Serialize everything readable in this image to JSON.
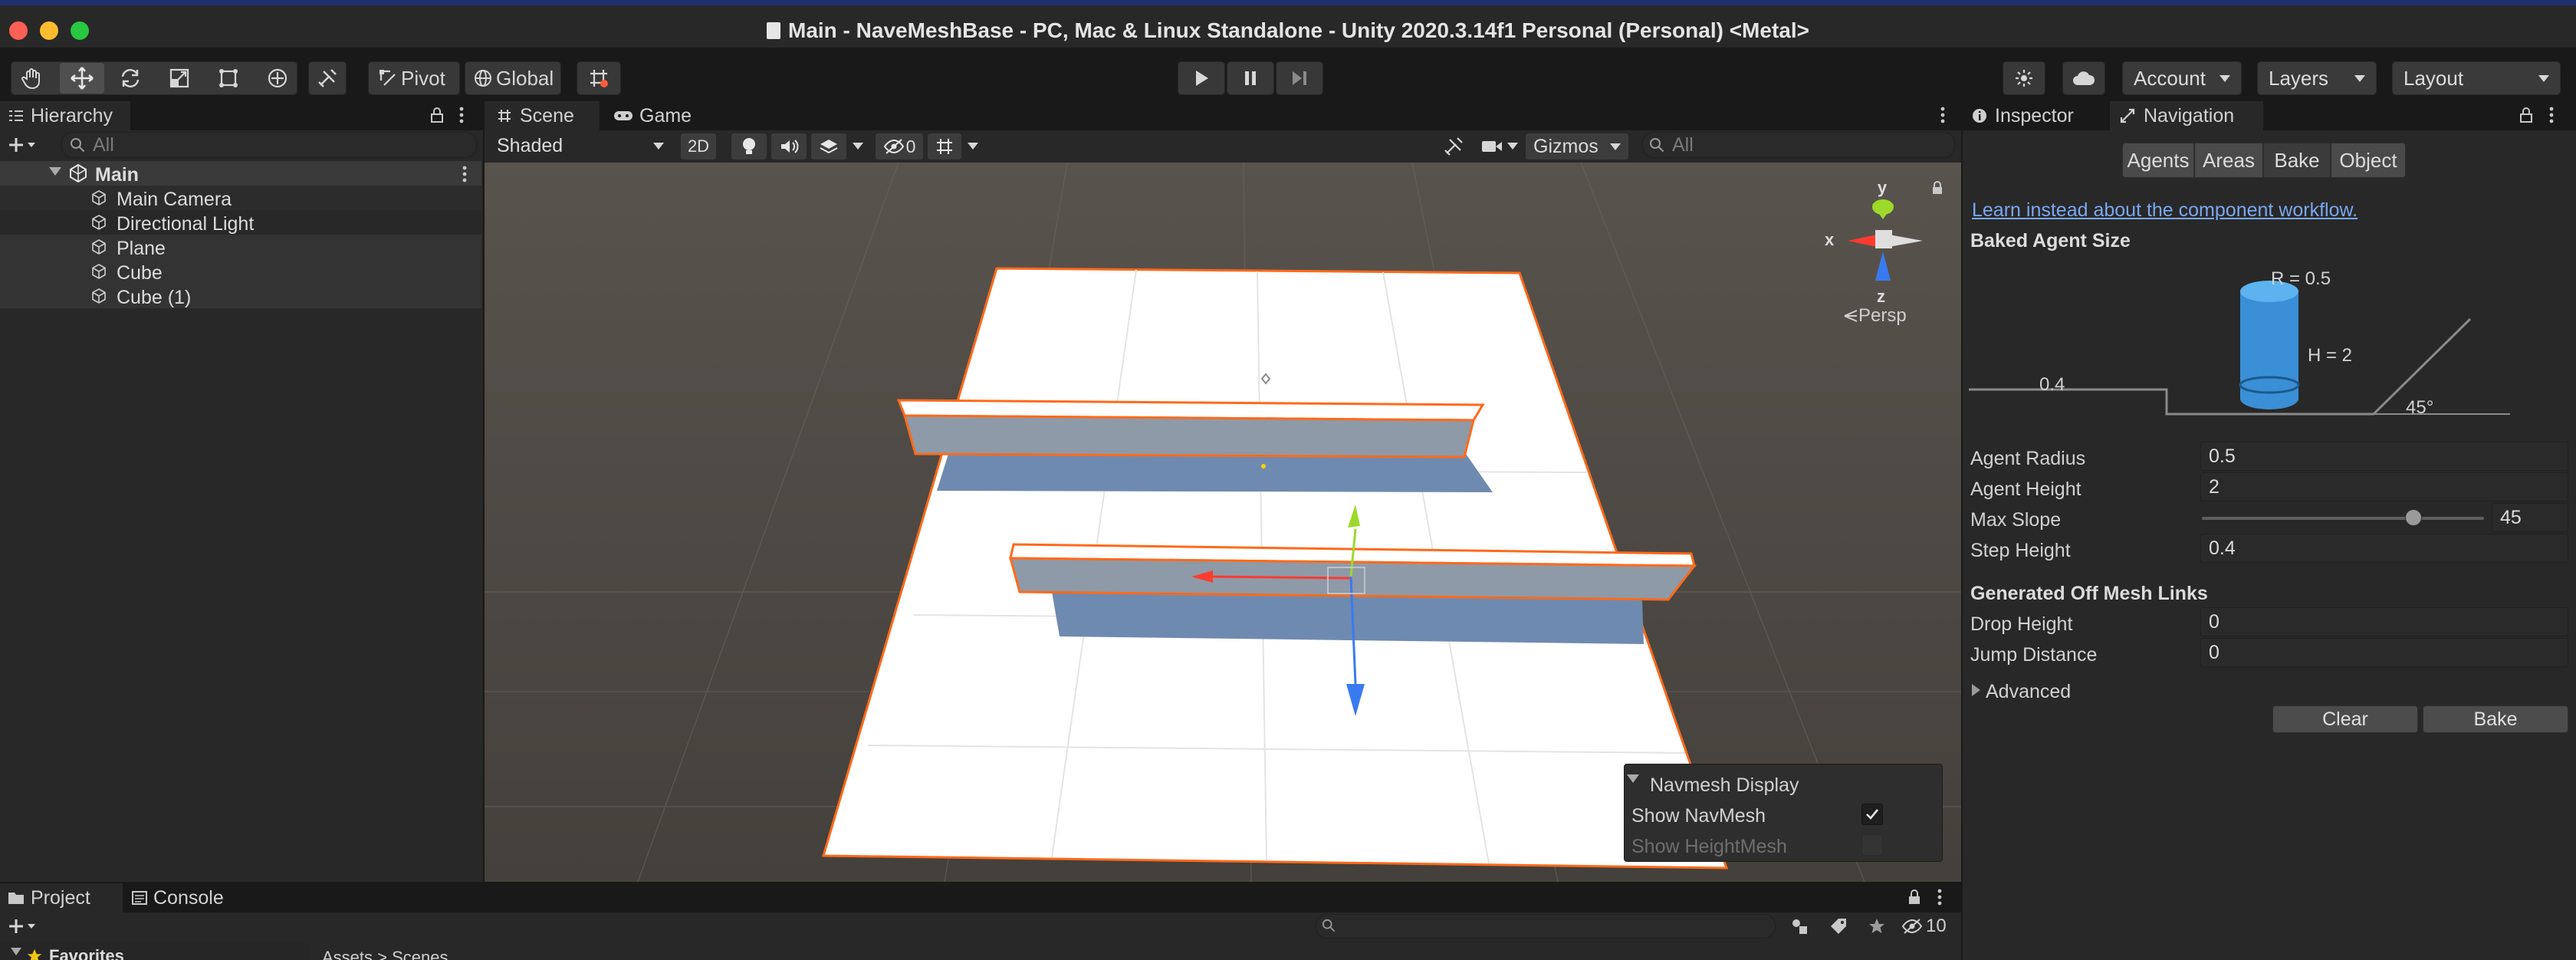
{
  "window": {
    "title": "Main - NaveMeshBase - PC, Mac & Linux Standalone - Unity 2020.3.14f1 Personal (Personal) <Metal>"
  },
  "toolbar": {
    "pivot": "Pivot",
    "global": "Global",
    "account": "Account",
    "layers": "Layers",
    "layout": "Layout"
  },
  "hierarchy": {
    "tab": "Hierarchy",
    "search_placeholder": "All",
    "scene": "Main",
    "items": [
      "Main Camera",
      "Directional Light",
      "Plane",
      "Cube",
      "Cube (1)"
    ]
  },
  "scene_view": {
    "tabs": [
      "Scene",
      "Game"
    ],
    "shading": "Shaded",
    "mode_2d": "2D",
    "hidden_count": "0",
    "gizmos": "Gizmos",
    "search_placeholder": "All",
    "axes": {
      "x": "x",
      "y": "y",
      "z": "z"
    },
    "persp": "Persp",
    "navmesh_overlay": {
      "title": "Navmesh Display",
      "show_navmesh": "Show NavMesh",
      "show_navmesh_checked": true,
      "show_heightmesh": "Show HeightMesh",
      "show_heightmesh_checked": false
    }
  },
  "inspector": {
    "tabs": [
      "Inspector",
      "Navigation"
    ],
    "nav_buttons": [
      "Agents",
      "Areas",
      "Bake",
      "Object"
    ],
    "selected_nav": "Bake",
    "link": "Learn instead about the component workflow.",
    "baked_agent_size": "Baked Agent Size",
    "diagram": {
      "r": "R = 0.5",
      "h": "H = 2",
      "step": "0.4",
      "slope": "45°"
    },
    "fields": {
      "agent_radius_label": "Agent Radius",
      "agent_radius": "0.5",
      "agent_height_label": "Agent Height",
      "agent_height": "2",
      "max_slope_label": "Max Slope",
      "max_slope": "45",
      "step_height_label": "Step Height",
      "step_height": "0.4"
    },
    "max_slope_slider_fraction": 0.75,
    "offmesh": {
      "header": "Generated Off Mesh Links",
      "drop_height_label": "Drop Height",
      "drop_height": "0",
      "jump_distance_label": "Jump Distance",
      "jump_distance": "0"
    },
    "advanced": "Advanced",
    "clear": "Clear",
    "bake": "Bake"
  },
  "bottom": {
    "tabs": [
      "Project",
      "Console"
    ],
    "favorites": "Favorites",
    "breadcrumb": "Assets > Scenes",
    "hidden_count": "10"
  }
}
